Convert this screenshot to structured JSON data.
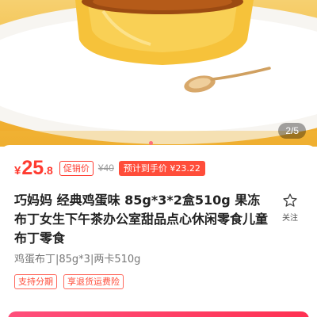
{
  "gallery": {
    "counter": "2/5"
  },
  "price": {
    "currency": "¥",
    "integer": "25",
    "decimal": ".8",
    "promo_tag": "促销价",
    "original": "¥40",
    "estimate": "预计到手价 ¥23.22"
  },
  "product": {
    "title": "巧妈妈 经典鸡蛋味 85g*3*2盒510g 果冻布丁女生下午茶办公室甜品点心休闲零食儿童布丁零食",
    "spec": "鸡蛋布丁|85g*3|两卡510g",
    "badges": [
      "支持分期",
      "享退货运费险"
    ]
  },
  "actions": {
    "follow_label": "关注"
  },
  "colors": {
    "price_red": "#ff3b30",
    "estimate_bg": "#ff4d3a",
    "hero_yellow": "#f2b93c"
  }
}
